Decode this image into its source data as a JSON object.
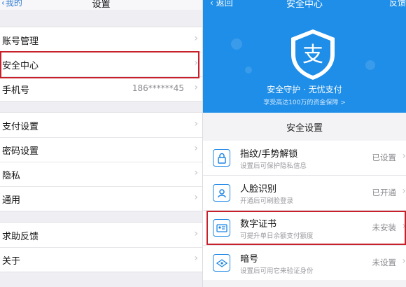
{
  "left": {
    "nav": {
      "back_label": "我的",
      "title": "设置"
    },
    "group1": [
      {
        "label": "账号管理",
        "value": ""
      },
      {
        "label": "安全中心",
        "value": ""
      },
      {
        "label": "手机号",
        "value": "186******45"
      }
    ],
    "group2": [
      {
        "label": "支付设置"
      },
      {
        "label": "密码设置"
      },
      {
        "label": "隐私"
      },
      {
        "label": "通用"
      }
    ],
    "group3": [
      {
        "label": "求助反馈"
      },
      {
        "label": "关于"
      }
    ]
  },
  "right": {
    "nav": {
      "back_label": "返回",
      "title": "安全中心",
      "feedback_label": "反馈"
    },
    "header": {
      "logo_char": "支",
      "slogan": "安全守护 · 无忧支付",
      "subtext": "享受高达100万的资金保障 >"
    },
    "section_title": "安全设置",
    "items": [
      {
        "title": "指纹/手势解锁",
        "desc": "设置后可保护隐私信息",
        "status": "已设置",
        "icon": "lock-icon"
      },
      {
        "title": "人脸识别",
        "desc": "开通后可刷脸登录",
        "status": "已开通",
        "icon": "face-id-icon"
      },
      {
        "title": "数字证书",
        "desc": "可提升单日余额支付额度",
        "status": "未安装",
        "icon": "certificate-icon"
      },
      {
        "title": "暗号",
        "desc": "设置后可用它来验证身份",
        "status": "未设置",
        "icon": "code-icon"
      }
    ]
  },
  "colors": {
    "accent": "#1e8ee8",
    "highlight_border": "#c8202a"
  }
}
